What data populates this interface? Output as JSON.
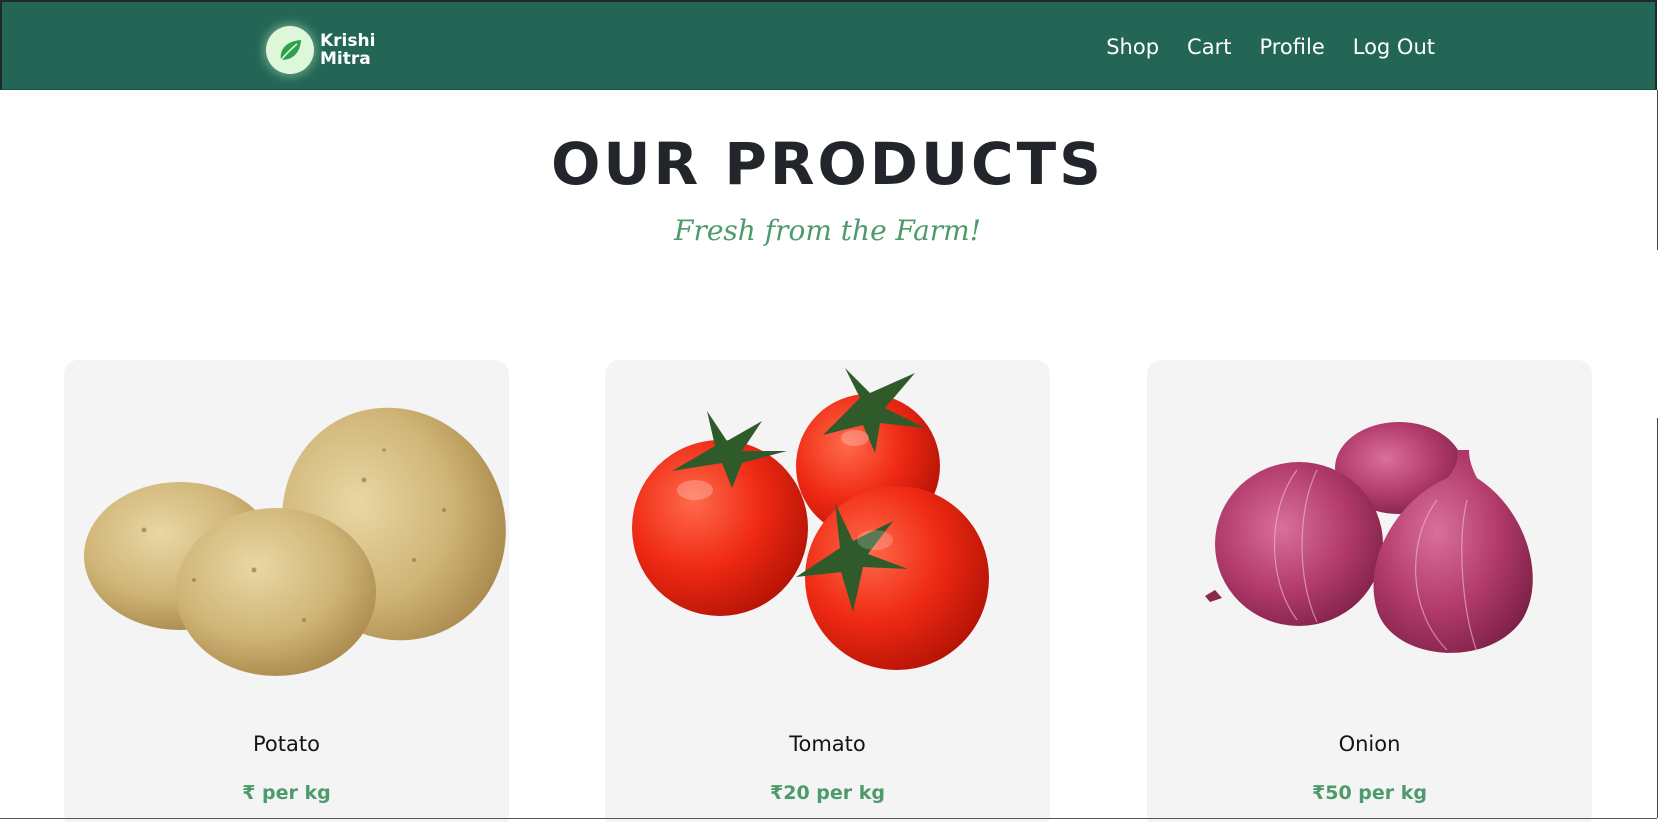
{
  "brand": {
    "name_line1": "Krishi",
    "name_line2": "Mitra",
    "icon": "leaf-icon",
    "bar_color": "#236656"
  },
  "nav": {
    "items": [
      {
        "label": "Shop"
      },
      {
        "label": "Cart"
      },
      {
        "label": "Profile"
      },
      {
        "label": "Log Out"
      }
    ]
  },
  "header": {
    "title": "OUR PRODUCTS",
    "subtitle": "Fresh from the Farm!"
  },
  "products": [
    {
      "name": "Potato",
      "price": "₹ per kg",
      "image_icon": "potato-image"
    },
    {
      "name": "Tomato",
      "price": "₹20 per kg",
      "image_icon": "tomato-image"
    },
    {
      "name": "Onion",
      "price": "₹50 per kg",
      "image_icon": "onion-image"
    }
  ],
  "colors": {
    "accent_green": "#4d9a6a",
    "card_bg": "#f4f4f5",
    "title_text": "#22262b"
  }
}
